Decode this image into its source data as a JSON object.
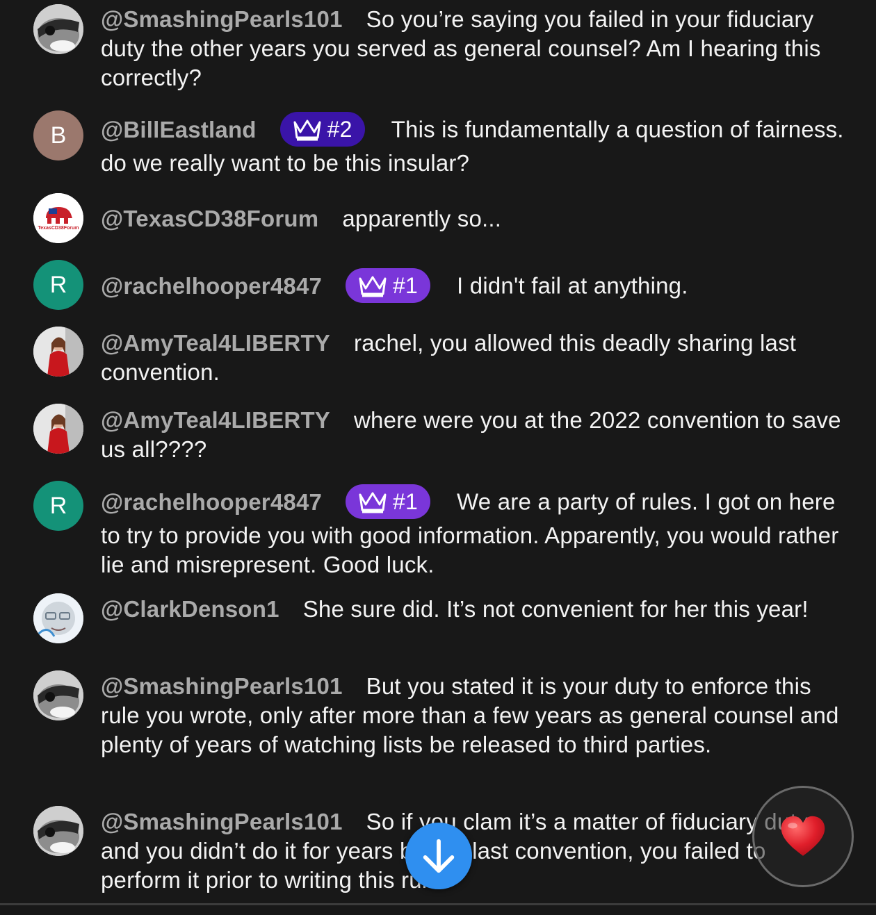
{
  "messages": [
    {
      "author": "@SmashingPearls101",
      "badge": "",
      "text": "So you’re saying you failed in your fiduciary duty the other years you served as general counsel? Am I hearing this correctly?"
    },
    {
      "author": "@BillEastland",
      "avatar_letter": "B",
      "badge": "#2",
      "text": "This is fundamentally a question of fairness. do we really want to be this insular?"
    },
    {
      "author": "@TexasCD38Forum",
      "avatar_label": "TexasCD38Forum",
      "badge": "",
      "text": "apparently so..."
    },
    {
      "author": "@rachelhooper4847",
      "avatar_letter": "R",
      "badge": "#1",
      "text": "I didn't fail at anything."
    },
    {
      "author": "@AmyTeal4LIBERTY",
      "badge": "",
      "text": "rachel, you allowed this deadly sharing last convention."
    },
    {
      "author": "@AmyTeal4LIBERTY",
      "badge": "",
      "text": "where were you at the 2022 convention to save us all????"
    },
    {
      "author": "@rachelhooper4847",
      "avatar_letter": "R",
      "badge": "#1",
      "text": "We are a party of rules. I got on here to try to provide you with good information. Apparently, you would rather lie and misrepresent. Good luck."
    },
    {
      "author": "@ClarkDenson1",
      "badge": "",
      "text": "She sure did. It’s not convenient for her this year!"
    },
    {
      "author": "@SmashingPearls101",
      "badge": "",
      "text": "But you stated it is your duty to enforce this rule you wrote, only after more than a few years as general counsel and plenty of years of watching lists be released to third parties."
    },
    {
      "author": "@SmashingPearls101",
      "badge": "",
      "text": "So if you clam it’s a matter of fiduciary duty, and you didn’t do it for years before last convention, you failed to perform it prior to writing this rule."
    }
  ],
  "colors": {
    "accent_purple": "#7a36d9",
    "badge_dark_purple": "#3a14a8",
    "scroll_button": "#2f8ff0",
    "author": "#aaaaaa",
    "background": "#181818"
  },
  "icons": {
    "badge": "crown-icon",
    "scroll": "arrow-down-icon",
    "reaction": "heart-icon"
  }
}
